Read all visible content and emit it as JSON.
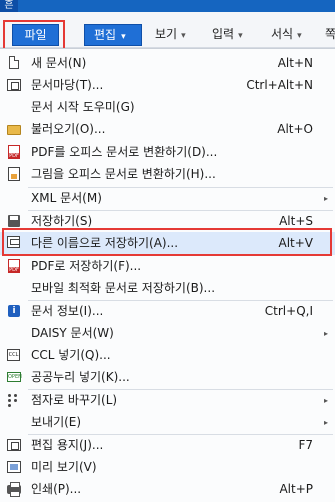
{
  "titlebar": {
    "app_glyph": "흔"
  },
  "menubar": {
    "file": "파일",
    "edit": "편집",
    "view": "보기",
    "input": "입력",
    "format": "서식",
    "more": "쪽",
    "caret": "▾"
  },
  "menu": {
    "items": [
      {
        "label": "새 문서(N)",
        "shortcut": "Alt+N",
        "icon": "new-document-icon"
      },
      {
        "label": "문서마당(T)...",
        "shortcut": "Ctrl+Alt+N",
        "icon": "template-icon"
      },
      {
        "label": "문서 시작 도우미(G)",
        "shortcut": "",
        "icon": ""
      },
      {
        "label": "불러오기(O)...",
        "shortcut": "Alt+O",
        "icon": "folder-icon"
      },
      {
        "label": "PDF를 오피스 문서로 변환하기(D)...",
        "shortcut": "",
        "icon": "pdf-icon"
      },
      {
        "label": "그림을 오피스 문서로 변환하기(H)...",
        "shortcut": "",
        "icon": "image-convert-icon"
      },
      {
        "label": "XML 문서(M)",
        "shortcut": "",
        "icon": "",
        "submenu": true
      },
      {
        "label": "저장하기(S)",
        "shortcut": "Alt+S",
        "icon": "save-icon"
      },
      {
        "label": "다른 이름으로 저장하기(A)...",
        "shortcut": "Alt+V",
        "icon": "save-as-icon"
      },
      {
        "label": "PDF로 저장하기(F)...",
        "shortcut": "",
        "icon": "pdf-save-icon"
      },
      {
        "label": "모바일 최적화 문서로 저장하기(B)...",
        "shortcut": "",
        "icon": ""
      },
      {
        "label": "문서 정보(I)...",
        "shortcut": "Ctrl+Q,I",
        "icon": "info-icon"
      },
      {
        "label": "DAISY 문서(W)",
        "shortcut": "",
        "icon": "",
        "submenu": true
      },
      {
        "label": "CCL 넣기(Q)...",
        "shortcut": "",
        "icon": "ccl-icon"
      },
      {
        "label": "공공누리 넣기(K)...",
        "shortcut": "",
        "icon": "kogl-icon"
      },
      {
        "label": "점자로 바꾸기(L)",
        "shortcut": "",
        "icon": "braille-icon",
        "submenu": true
      },
      {
        "label": "보내기(E)",
        "shortcut": "",
        "icon": "",
        "submenu": true
      },
      {
        "label": "편집 용지(J)...",
        "shortcut": "F7",
        "icon": "page-setup-icon"
      },
      {
        "label": "미리 보기(V)",
        "shortcut": "",
        "icon": "preview-icon"
      },
      {
        "label": "인쇄(P)...",
        "shortcut": "Alt+P",
        "icon": "printer-icon"
      }
    ],
    "submenu_arrow": "▸"
  },
  "colors": {
    "accent": "#1f6fd6",
    "highlight": "#dce9fb",
    "callout": "#e53935"
  }
}
